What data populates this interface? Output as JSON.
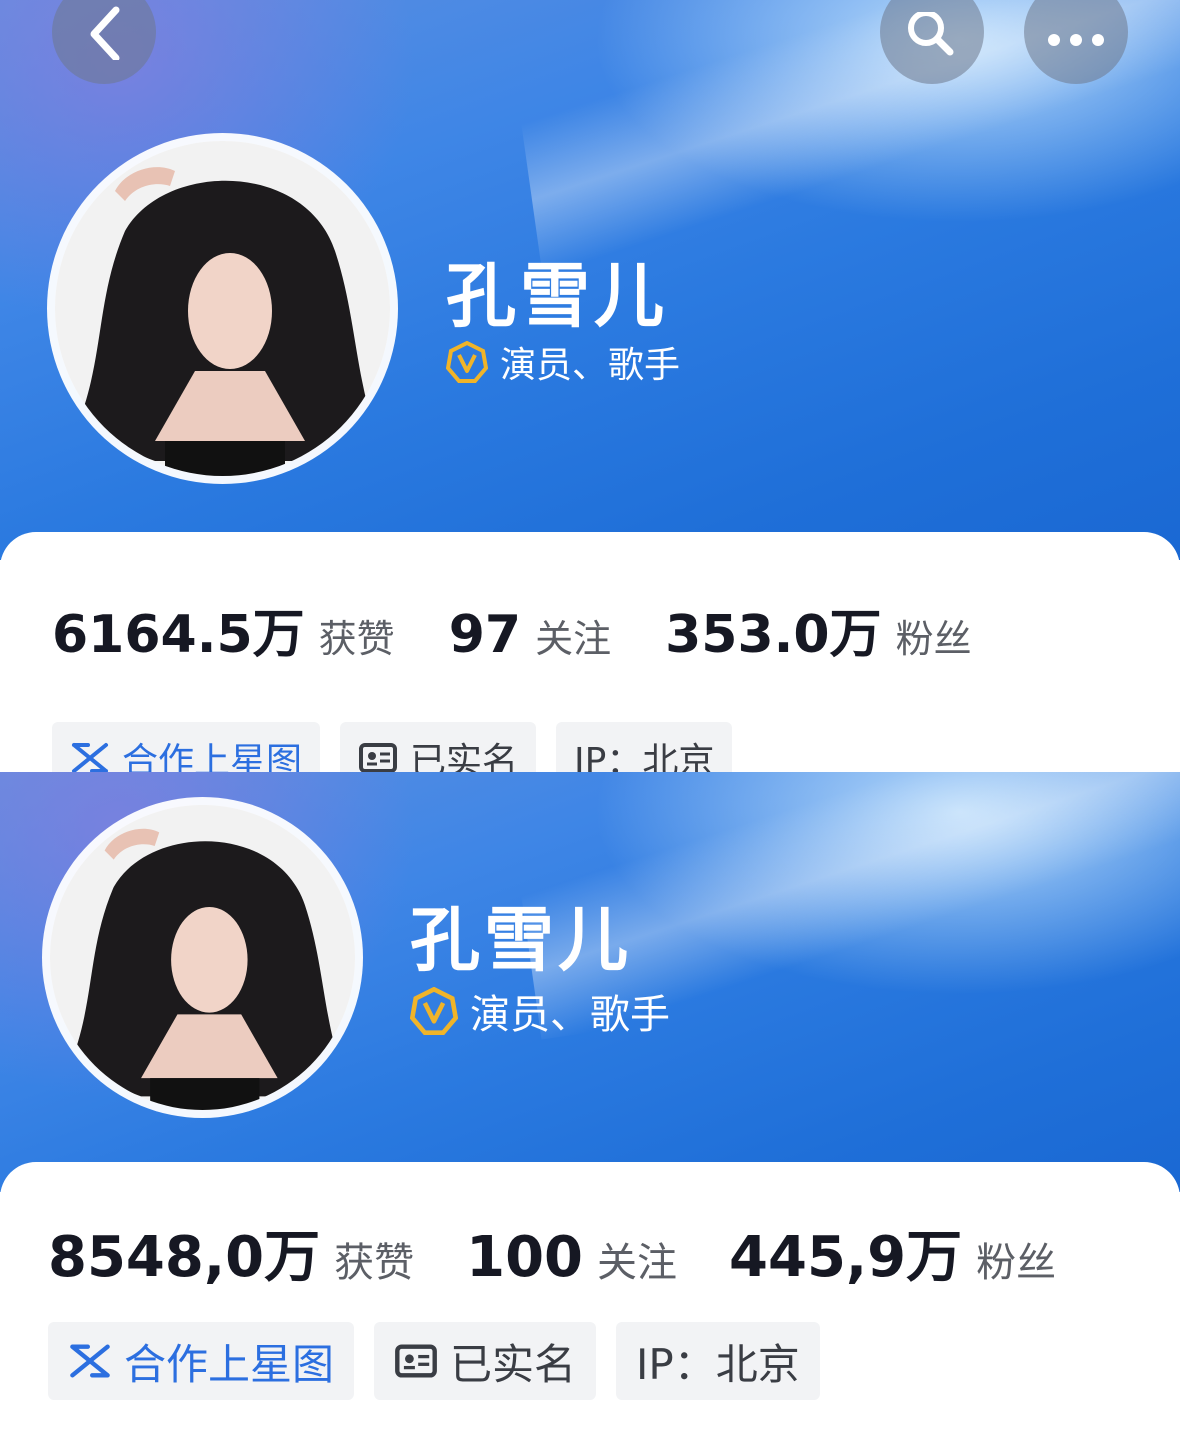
{
  "profiles": [
    {
      "name": "孔雪儿",
      "certification": "演员、歌手",
      "stats": {
        "likes": {
          "value": "6164.5万",
          "label": "获赞"
        },
        "following": {
          "value": "97",
          "label": "关注"
        },
        "fans": {
          "value": "353.0万",
          "label": "粉丝"
        }
      },
      "tags": {
        "star_map": "合作上星图",
        "verified": "已实名",
        "ip": "IP：北京"
      }
    },
    {
      "name": "孔雪儿",
      "certification": "演员、歌手",
      "stats": {
        "likes": {
          "value": "8548,0万",
          "label": "获赞"
        },
        "following": {
          "value": "100",
          "label": "关注"
        },
        "fans": {
          "value": "445,9万",
          "label": "粉丝"
        }
      },
      "tags": {
        "star_map": "合作上星图",
        "verified": "已实名",
        "ip": "IP：北京"
      }
    }
  ],
  "icons": {
    "back": "chevron-left-icon",
    "search": "search-icon",
    "more": "more-icon",
    "verified_badge": "v-badge-icon",
    "star_map": "star-map-icon",
    "id_card": "id-card-icon"
  },
  "colors": {
    "banner_blue": "#1f6fd8",
    "badge_gold": "#f0b429",
    "star_blue": "#2c6fe0",
    "text_dark": "#161823",
    "text_gray": "#5c5f66",
    "tag_bg": "#f2f3f5"
  }
}
